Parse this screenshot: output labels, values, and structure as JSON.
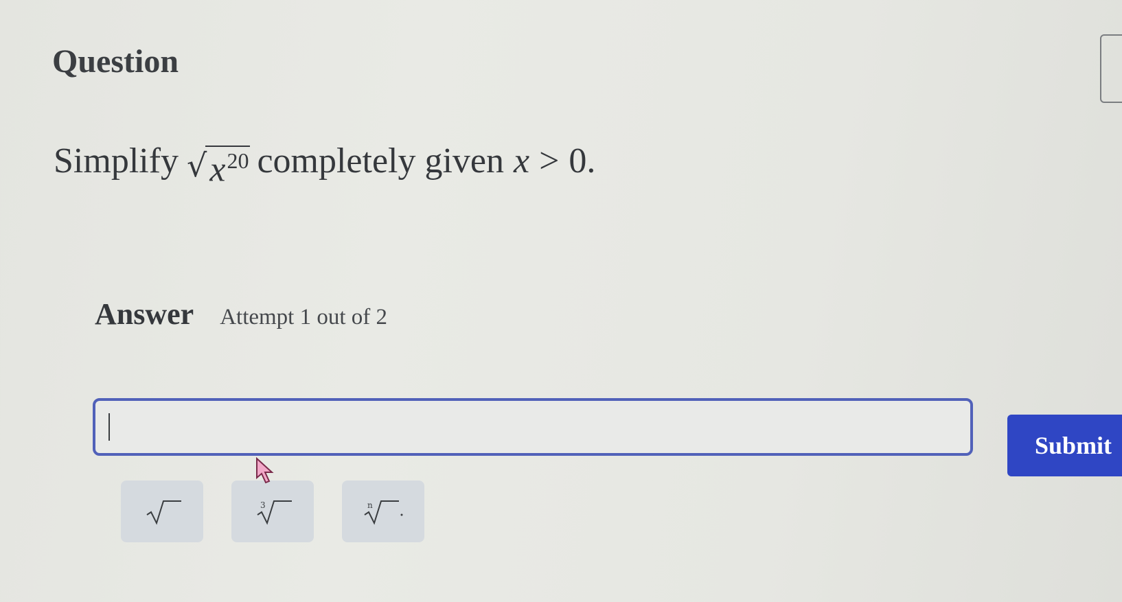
{
  "question": {
    "heading": "Question",
    "prefix": "Simplify",
    "radicand_base": "x",
    "radicand_exponent": "20",
    "middle": "completely given",
    "variable": "x",
    "relation": ">",
    "value": "0."
  },
  "answer": {
    "label": "Answer",
    "attempt": "Attempt 1 out of 2",
    "input_value": "",
    "submit_label": "Submit"
  },
  "math_keys": [
    {
      "icon": "square-root-icon",
      "index": ""
    },
    {
      "icon": "cube-root-icon",
      "index": "3"
    },
    {
      "icon": "nth-root-icon",
      "index": "n"
    }
  ],
  "colors": {
    "accent": "#2f46c4",
    "input_border": "#5161b9"
  }
}
